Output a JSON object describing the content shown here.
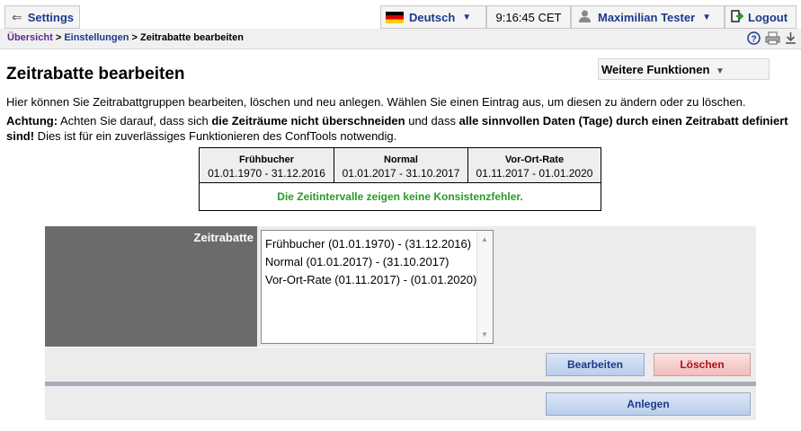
{
  "topbar": {
    "settings_label": "Settings",
    "language_label": "Deutsch",
    "time": "9:16:45 CET",
    "user_name": "Maximilian Tester",
    "logout_label": "Logout"
  },
  "breadcrumb": {
    "overview": "Übersicht",
    "settings": "Einstellungen",
    "current": "Zeitrabatte bearbeiten",
    "sep": ">"
  },
  "page": {
    "title": "Zeitrabatte bearbeiten",
    "more_functions": "Weitere Funktionen",
    "intro": "Hier können Sie Zeitrabattgruppen bearbeiten, löschen und neu anlegen. Wählen Sie einen Eintrag aus, um diesen zu ändern oder zu löschen.",
    "warning": {
      "p1": "Achtung:",
      "p2": " Achten Sie darauf, dass sich ",
      "p3": "die Zeiträume nicht überschneiden",
      "p4": " und dass ",
      "p5": "alle sinnvollen Daten (Tage) durch einen Zeitrabatt definiert sind!",
      "p6": " Dies ist für ein zuverlässiges Funktionieren des ConfTools notwendig."
    }
  },
  "periods": [
    {
      "name": "Frühbucher",
      "range": "01.01.1970 - 31.12.2016"
    },
    {
      "name": "Normal",
      "range": "01.01.2017 - 31.10.2017"
    },
    {
      "name": "Vor-Ort-Rate",
      "range": "01.11.2017 - 01.01.2020"
    }
  ],
  "consistency_message": "Die Zeitintervalle zeigen keine Konsistenzfehler.",
  "form": {
    "label": "Zeitrabatte",
    "options": [
      "Frühbucher (01.01.1970) - (31.12.2016)",
      "Normal (01.01.2017) - (31.10.2017)",
      "Vor-Ort-Rate (01.11.2017) - (01.01.2020)"
    ],
    "edit_label": "Bearbeiten",
    "delete_label": "Löschen",
    "create_label": "Anlegen"
  },
  "colors": {
    "link": "#1a3a8c",
    "success": "#2a9a2a",
    "delete": "#b01010",
    "label_panel": "#6b6b6b"
  }
}
